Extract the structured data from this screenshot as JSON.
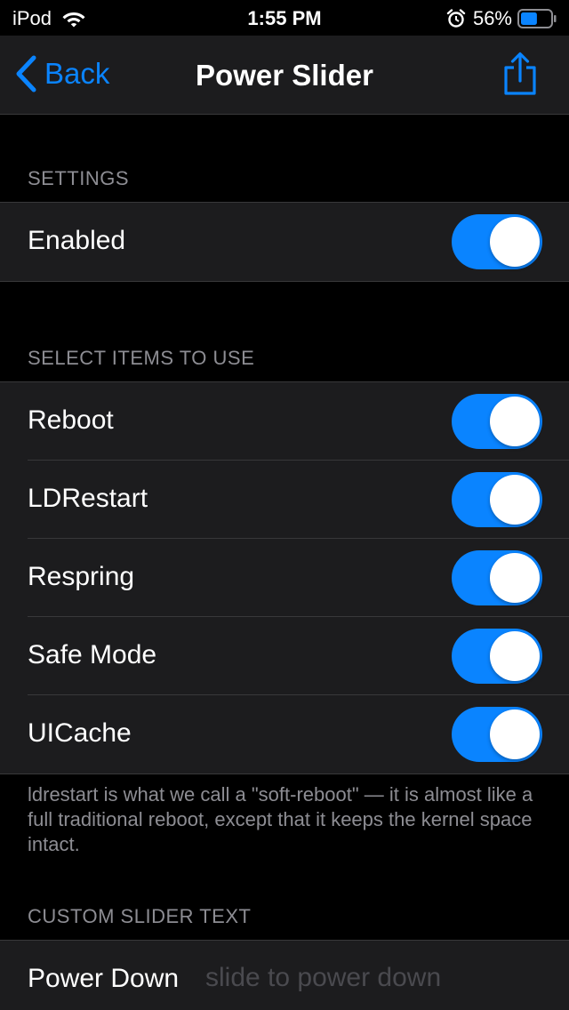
{
  "status_bar": {
    "device": "iPod",
    "time": "1:55 PM",
    "battery_percent": "56%",
    "battery_level": 0.56
  },
  "nav": {
    "back_label": "Back",
    "title": "Power Slider",
    "accent": "#0a84ff"
  },
  "settings": {
    "header": "SETTINGS",
    "enabled": {
      "label": "Enabled",
      "on": true
    }
  },
  "items": {
    "header": "SELECT ITEMS TO USE",
    "rows": [
      {
        "label": "Reboot",
        "on": true
      },
      {
        "label": "LDRestart",
        "on": true
      },
      {
        "label": "Respring",
        "on": true
      },
      {
        "label": "Safe Mode",
        "on": true
      },
      {
        "label": "UICache",
        "on": true
      }
    ],
    "footer": "ldrestart is what we call a \"soft-reboot\" — it is almost like a full traditional reboot, except that it keeps the kernel space intact."
  },
  "custom_text": {
    "header": "CUSTOM SLIDER TEXT",
    "power_down": {
      "label": "Power Down",
      "value": "",
      "placeholder": "slide to power down"
    }
  }
}
